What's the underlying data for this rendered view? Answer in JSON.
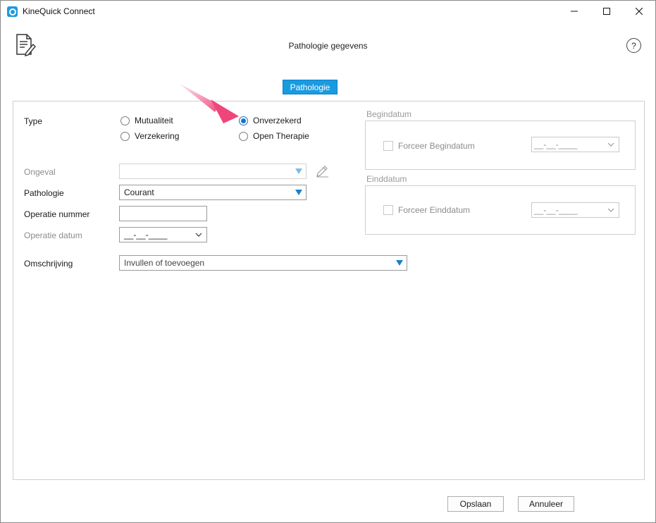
{
  "window": {
    "title": "KineQuick Connect"
  },
  "header": {
    "page_title": "Pathologie gegevens",
    "help_symbol": "?"
  },
  "tabs": [
    {
      "label": "Pathologie",
      "active": true
    }
  ],
  "form": {
    "type": {
      "label": "Type",
      "options": [
        {
          "label": "Mutualiteit",
          "checked": false
        },
        {
          "label": "Onverzekerd",
          "checked": true
        },
        {
          "label": "Verzekering",
          "checked": false
        },
        {
          "label": "Open Therapie",
          "checked": false
        }
      ]
    },
    "ongeval": {
      "label": "Ongeval",
      "value": ""
    },
    "pathologie": {
      "label": "Pathologie",
      "value": "Courant"
    },
    "operatie_nummer": {
      "label": "Operatie nummer",
      "value": ""
    },
    "operatie_datum": {
      "label": "Operatie datum",
      "value": "__-__-____"
    },
    "omschrijving": {
      "label": "Omschrijving",
      "value": "Invullen of toevoegen"
    }
  },
  "begindatum": {
    "group_title": "Begindatum",
    "checkbox_label": "Forceer Begindatum",
    "date_value": "__-__-____"
  },
  "einddatum": {
    "group_title": "Einddatum",
    "checkbox_label": "Forceer Einddatum",
    "date_value": "__-__-____"
  },
  "footer": {
    "save_label": "Opslaan",
    "cancel_label": "Annuleer"
  },
  "colors": {
    "accent": "#1a9be0",
    "annotation_arrow": "#f0457a"
  },
  "icons": {
    "app": "app-logo-icon",
    "document": "document-edit-icon",
    "help": "help-icon",
    "edit": "pencil-icon"
  }
}
